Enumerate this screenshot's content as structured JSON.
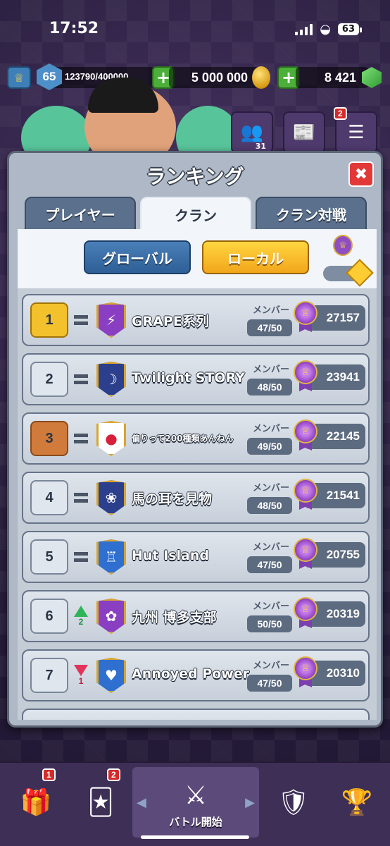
{
  "status_bar": {
    "time": "17:52",
    "battery": "63"
  },
  "resources": {
    "level": "65",
    "xp": "123790/400000",
    "gold": "5 000 000",
    "gems": "8 421"
  },
  "top_buttons": {
    "friends_count": "31",
    "menu_badge": "2"
  },
  "panel": {
    "title": "ランキング",
    "tabs": [
      "プレイヤー",
      "クラン",
      "クラン対戦"
    ],
    "active_tab": "クラン",
    "filters": {
      "global": "グローバル",
      "local": "ローカル",
      "active": "ローカル"
    }
  },
  "clans": [
    {
      "rank": "1",
      "change": "=",
      "change_num": "",
      "name": "GRAPE系列",
      "member_label": "メンバー",
      "members": "47/50",
      "trophies": "27157",
      "badge_color": "#8a3fc2",
      "badge_icon": "lightning-icon"
    },
    {
      "rank": "2",
      "change": "=",
      "change_num": "",
      "name": "Twilight STORY",
      "member_label": "メンバー",
      "members": "48/50",
      "trophies": "23941",
      "badge_color": "#2b3f8c",
      "badge_icon": "moon-icon"
    },
    {
      "rank": "3",
      "change": "=",
      "change_num": "",
      "name": "偏りって200種類あんねん",
      "member_label": "メンバー",
      "members": "49/50",
      "trophies": "22145",
      "badge_color": "#ffffff",
      "badge_icon": "red-circle-icon"
    },
    {
      "rank": "4",
      "change": "=",
      "change_num": "",
      "name": "馬の耳を見物",
      "member_label": "メンバー",
      "members": "48/50",
      "trophies": "21541",
      "badge_color": "#2b3f8c",
      "badge_icon": "lotus-icon"
    },
    {
      "rank": "5",
      "change": "=",
      "change_num": "",
      "name": "Hut Island",
      "member_label": "メンバー",
      "members": "47/50",
      "trophies": "20755",
      "badge_color": "#2f6fd0",
      "badge_icon": "tower-icon"
    },
    {
      "rank": "6",
      "change": "up",
      "change_num": "2",
      "name": "九州 博多支部",
      "member_label": "メンバー",
      "members": "50/50",
      "trophies": "20319",
      "badge_color": "#8a3fc2",
      "badge_icon": "flower-icon"
    },
    {
      "rank": "7",
      "change": "down",
      "change_num": "1",
      "name": "Annoyed Power",
      "member_label": "メンバー",
      "members": "47/50",
      "trophies": "20310",
      "badge_color": "#2f6fd0",
      "badge_icon": "heart-icon"
    }
  ],
  "bottom_nav": {
    "shop_badge": "1",
    "cards_badge": "2",
    "battle_label": "バトル開始"
  }
}
